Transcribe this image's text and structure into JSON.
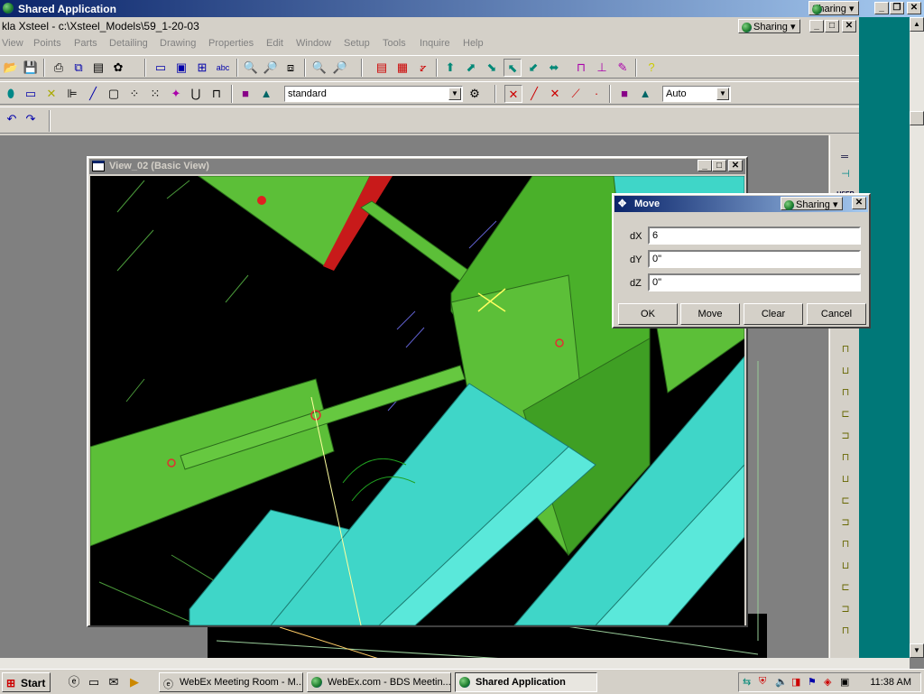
{
  "outer_window": {
    "title": "Shared Application",
    "sharing_label": "Sharing"
  },
  "app_window": {
    "title": "kla Xsteel - c:\\Xsteel_Models\\59_1-20-03",
    "sharing_label": "Sharing"
  },
  "menu": [
    "View",
    "Points",
    "Parts",
    "Detailing",
    "Drawing",
    "Properties",
    "Edit",
    "Window",
    "Setup",
    "Tools",
    "Inquire",
    "Help"
  ],
  "toolbar2": {
    "standard_combo": "standard",
    "auto_combo": "Auto"
  },
  "view_window": {
    "title": "View_02 (Basic View)"
  },
  "move_dialog": {
    "title": "Move",
    "sharing_label": "Sharing",
    "fields": [
      {
        "label": "dX",
        "value": "6"
      },
      {
        "label": "dY",
        "value": "0\""
      },
      {
        "label": "dZ",
        "value": "0\""
      }
    ],
    "buttons": [
      "OK",
      "Move",
      "Clear",
      "Cancel"
    ]
  },
  "taskbar": {
    "start_label": "Start",
    "tasks": [
      "WebEx Meeting Room - M...",
      "WebEx.com - BDS Meetin...",
      "Shared Application"
    ],
    "clock": "11:38 AM"
  },
  "colors": {
    "title_active": "#0a246a",
    "model_green": "#5fbf3a",
    "model_cyan": "#3fd6c8",
    "desktop_teal": "#007878"
  }
}
